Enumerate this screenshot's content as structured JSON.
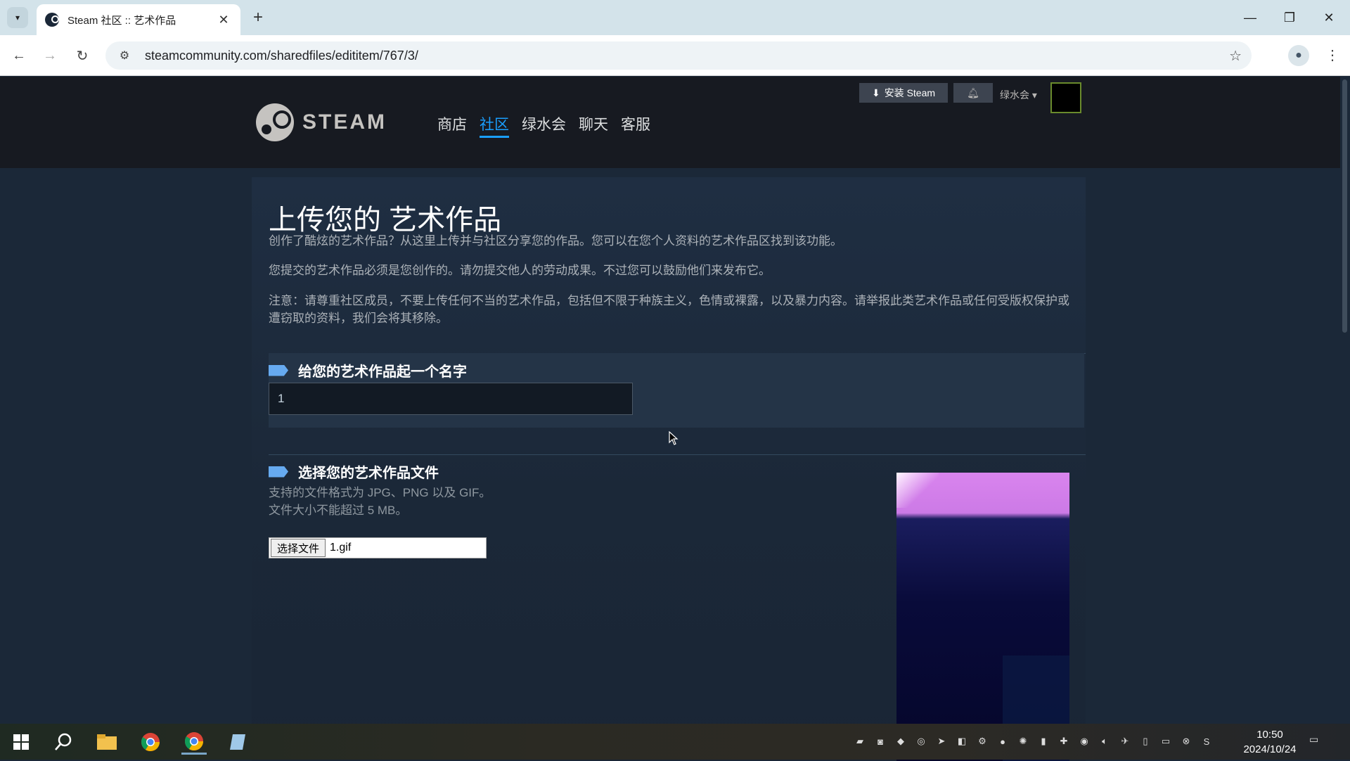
{
  "browser": {
    "tab_title": "Steam 社区 :: 艺术作品",
    "url": "steamcommunity.com/sharedfiles/edititem/767/3/"
  },
  "steam": {
    "logo_text": "STEAM",
    "nav": [
      "商店",
      "社区",
      "绿水会",
      "聊天",
      "客服"
    ],
    "install_label": "安装 Steam",
    "account_name": "绿水会"
  },
  "page": {
    "title": "上传您的 艺术作品",
    "desc1": "创作了酷炫的艺术作品？从这里上传并与社区分享您的作品。您可以在您个人资料的艺术作品区找到该功能。",
    "desc2": "您提交的艺术作品必须是您创作的。请勿提交他人的劳动成果。不过您可以鼓励他们来发布它。",
    "desc3": "注意：请尊重社区成员，不要上传任何不当的艺术作品，包括但不限于种族主义，色情或裸露，以及暴力内容。请举报此类艺术作品或任何受版权保护或遭窃取的资料，我们会将其移除。",
    "section_name_label": "给您的艺术作品起一个名字",
    "name_value": "1",
    "section_file_label": "选择您的艺术作品文件",
    "formats_line1": "支持的文件格式为 JPG、PNG 以及 GIF。",
    "formats_line2": "文件大小不能超过 5 MB。",
    "file_button": "选择文件",
    "file_name": "1.gif"
  },
  "taskbar": {
    "time": "10:50",
    "date": "2024/10/24"
  }
}
